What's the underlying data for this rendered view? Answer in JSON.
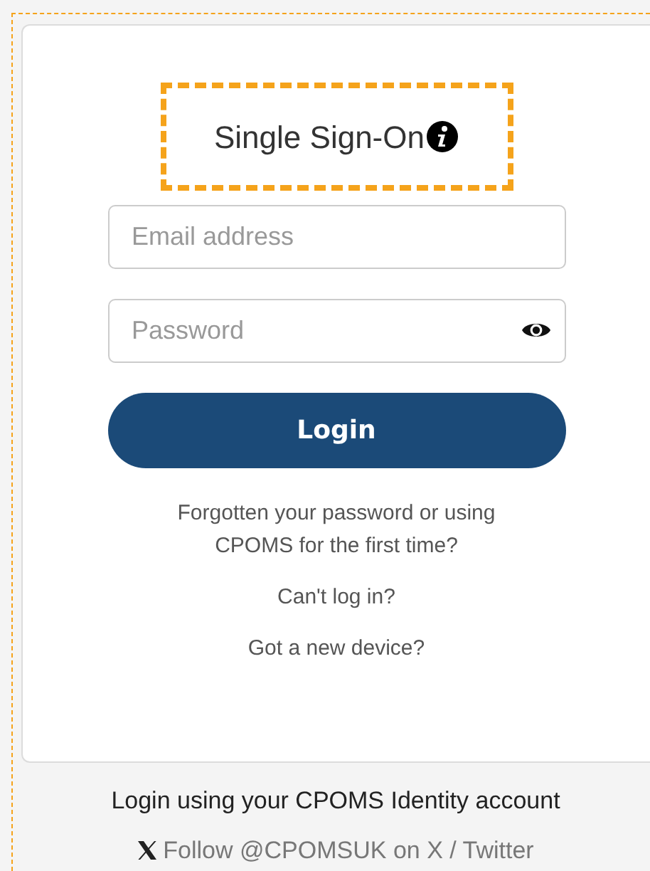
{
  "title": "Single Sign-On",
  "email": {
    "placeholder": "Email address"
  },
  "password": {
    "placeholder": "Password"
  },
  "login_button": "Login",
  "links": [
    "Forgotten your password or using CPOMS for the first time?",
    "Can't log in?",
    "Got a new device?"
  ],
  "footer": {
    "note": "Login using your CPOMS Identity account",
    "follow_link": "Follow @CPOMSUK on X / Twitter"
  }
}
